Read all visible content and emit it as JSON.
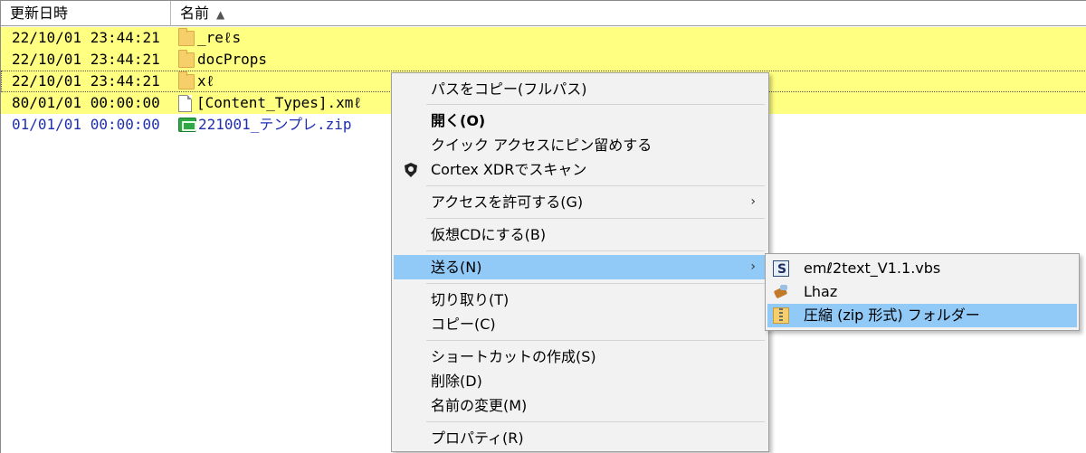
{
  "header": {
    "col_date": "更新日時",
    "col_name": "名前"
  },
  "files": [
    {
      "date": "22/10/01 23:44:21",
      "name": "_reℓs",
      "icon": "folder-icon"
    },
    {
      "date": "22/10/01 23:44:21",
      "name": "docProps",
      "icon": "folder-icon"
    },
    {
      "date": "22/10/01 23:44:21",
      "name": "xℓ",
      "icon": "folder-icon"
    },
    {
      "date": "80/01/01 00:00:00",
      "name": "[Content_Types].xmℓ",
      "icon": "file-icon"
    },
    {
      "date": "01/01/01 00:00:00",
      "name": "221001_テンプレ.zip",
      "icon": "zip-icon"
    }
  ],
  "context_menu": {
    "items": [
      "パスをコピー(フルパス)",
      "開く(O)",
      "クイック アクセスにピン留めする",
      "Cortex XDRでスキャン",
      "アクセスを許可する(G)",
      "仮想CDにする(B)",
      "送る(N)",
      "切り取り(T)",
      "コピー(C)",
      "ショートカットの作成(S)",
      "削除(D)",
      "名前の変更(M)",
      "プロパティ(R)"
    ]
  },
  "send_to_menu": {
    "items": [
      "emℓ2text_V1.1.vbs",
      "Lhaz",
      "圧縮 (zip 形式) フォルダー"
    ]
  },
  "colors": {
    "highlight_row": "#ffff82",
    "menu_hover": "#91c9f7",
    "link_blue": "#1f2fb0"
  }
}
